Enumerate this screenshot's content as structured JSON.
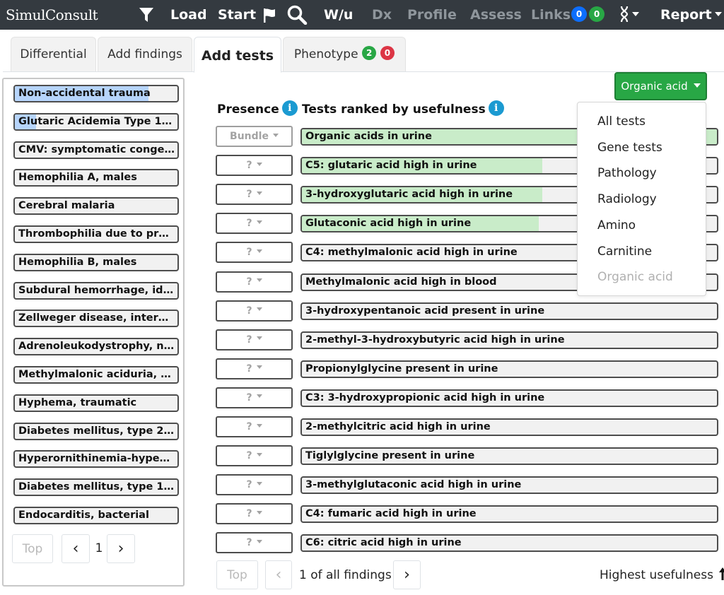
{
  "navbar": {
    "brand": "SimulConsult",
    "load": "Load",
    "start": "Start",
    "wu": "W/u",
    "dx": "Dx",
    "profile": "Profile",
    "assess": "Assess",
    "links": "Links",
    "links_badge_blue": "0",
    "links_badge_green": "0",
    "report": "Report",
    "icons": [
      "filter-icon",
      "flag-icon",
      "search-icon",
      "dna-icon"
    ]
  },
  "tabs": [
    {
      "label": "Differential"
    },
    {
      "label": "Add findings"
    },
    {
      "label": "Add tests"
    },
    {
      "label": "Phenotype",
      "badge_green": "2",
      "badge_red": "0"
    }
  ],
  "differential": {
    "items": [
      {
        "label": "Non-accidental trauma",
        "score": 0.82
      },
      {
        "label": "Glutaric Acidemia Type 1, i...",
        "score": 0.13
      },
      {
        "label": "CMV: symptomatic congen...",
        "score": 0
      },
      {
        "label": "Hemophilia A, males",
        "score": 0
      },
      {
        "label": "Cerebral malaria",
        "score": 0
      },
      {
        "label": "Thrombophilia due to prot...",
        "score": 0
      },
      {
        "label": "Hemophilia B, males",
        "score": 0
      },
      {
        "label": "Subdural hemorrhage, idio...",
        "score": 0
      },
      {
        "label": "Zellweger disease, interme...",
        "score": 0
      },
      {
        "label": "Adrenoleukodystrophy, ne...",
        "score": 0
      },
      {
        "label": "Methylmalonic aciduria, ho...",
        "score": 0
      },
      {
        "label": "Hyphema, traumatic",
        "score": 0
      },
      {
        "label": "Diabetes mellitus, type 2, i...",
        "score": 0
      },
      {
        "label": "Hyperornithinemia-hypera...",
        "score": 0
      },
      {
        "label": "Diabetes mellitus, type 1, i...",
        "score": 0
      },
      {
        "label": "Endocarditis, bacterial",
        "score": 0
      }
    ],
    "pager": {
      "top": "Top",
      "page": "1",
      "prev": "‹",
      "next": "›"
    }
  },
  "tests": {
    "presence_header": "Presence",
    "ranked_header": "Tests ranked by usefulness",
    "info_glyph": "i",
    "filter_label": "Organic acid",
    "dropdown_options": [
      {
        "label": "All tests",
        "disabled": false
      },
      {
        "label": "Gene tests",
        "disabled": false
      },
      {
        "label": "Pathology",
        "disabled": false
      },
      {
        "label": "Radiology",
        "disabled": false
      },
      {
        "label": "Amino",
        "disabled": false
      },
      {
        "label": "Carnitine",
        "disabled": false
      },
      {
        "label": "Organic acid",
        "disabled": true
      }
    ],
    "rows": [
      {
        "presence": "Bundle",
        "label": "Organic acids in urine",
        "usefulness": 1.0
      },
      {
        "presence": "?",
        "label": "C5: glutaric acid high in urine",
        "usefulness": 0.58
      },
      {
        "presence": "?",
        "label": "3-hydroxyglutaric acid high in urine",
        "usefulness": 0.58
      },
      {
        "presence": "?",
        "label": "Glutaconic acid high in urine",
        "usefulness": 0.57
      },
      {
        "presence": "?",
        "label": "C4: methylmalonic acid high in urine",
        "usefulness": 0
      },
      {
        "presence": "?",
        "label": "Methylmalonic acid high in blood",
        "usefulness": 0
      },
      {
        "presence": "?",
        "label": "3-hydroxypentanoic acid present in urine",
        "usefulness": 0
      },
      {
        "presence": "?",
        "label": "2-methyl-3-hydroxybutyric acid high in urine",
        "usefulness": 0
      },
      {
        "presence": "?",
        "label": "Propionylglycine present in urine",
        "usefulness": 0
      },
      {
        "presence": "?",
        "label": "C3: 3-hydroxypropionic acid high in urine",
        "usefulness": 0
      },
      {
        "presence": "?",
        "label": "2-methylcitric acid high in urine",
        "usefulness": 0
      },
      {
        "presence": "?",
        "label": "Tiglylglycine present in urine",
        "usefulness": 0
      },
      {
        "presence": "?",
        "label": "3-methylglutaconic acid high in urine",
        "usefulness": 0
      },
      {
        "presence": "?",
        "label": "C4: fumaric acid high in urine",
        "usefulness": 0
      },
      {
        "presence": "?",
        "label": "C6: citric acid high in urine",
        "usefulness": 0
      }
    ],
    "pager": {
      "top": "Top",
      "prev": "‹",
      "next": "›",
      "status": "1 of all findings"
    },
    "sort_label": "Highest usefulness",
    "sort_glyph": "🠕"
  },
  "colors": {
    "navbar": "#343a40",
    "accent_green": "#28a745",
    "badge_blue": "#0d6efd",
    "badge_red": "#dc3545",
    "info_blue": "#1b9ad1",
    "dx_fill": "#b6d4fb",
    "test_fill": "#c9ecc9"
  }
}
